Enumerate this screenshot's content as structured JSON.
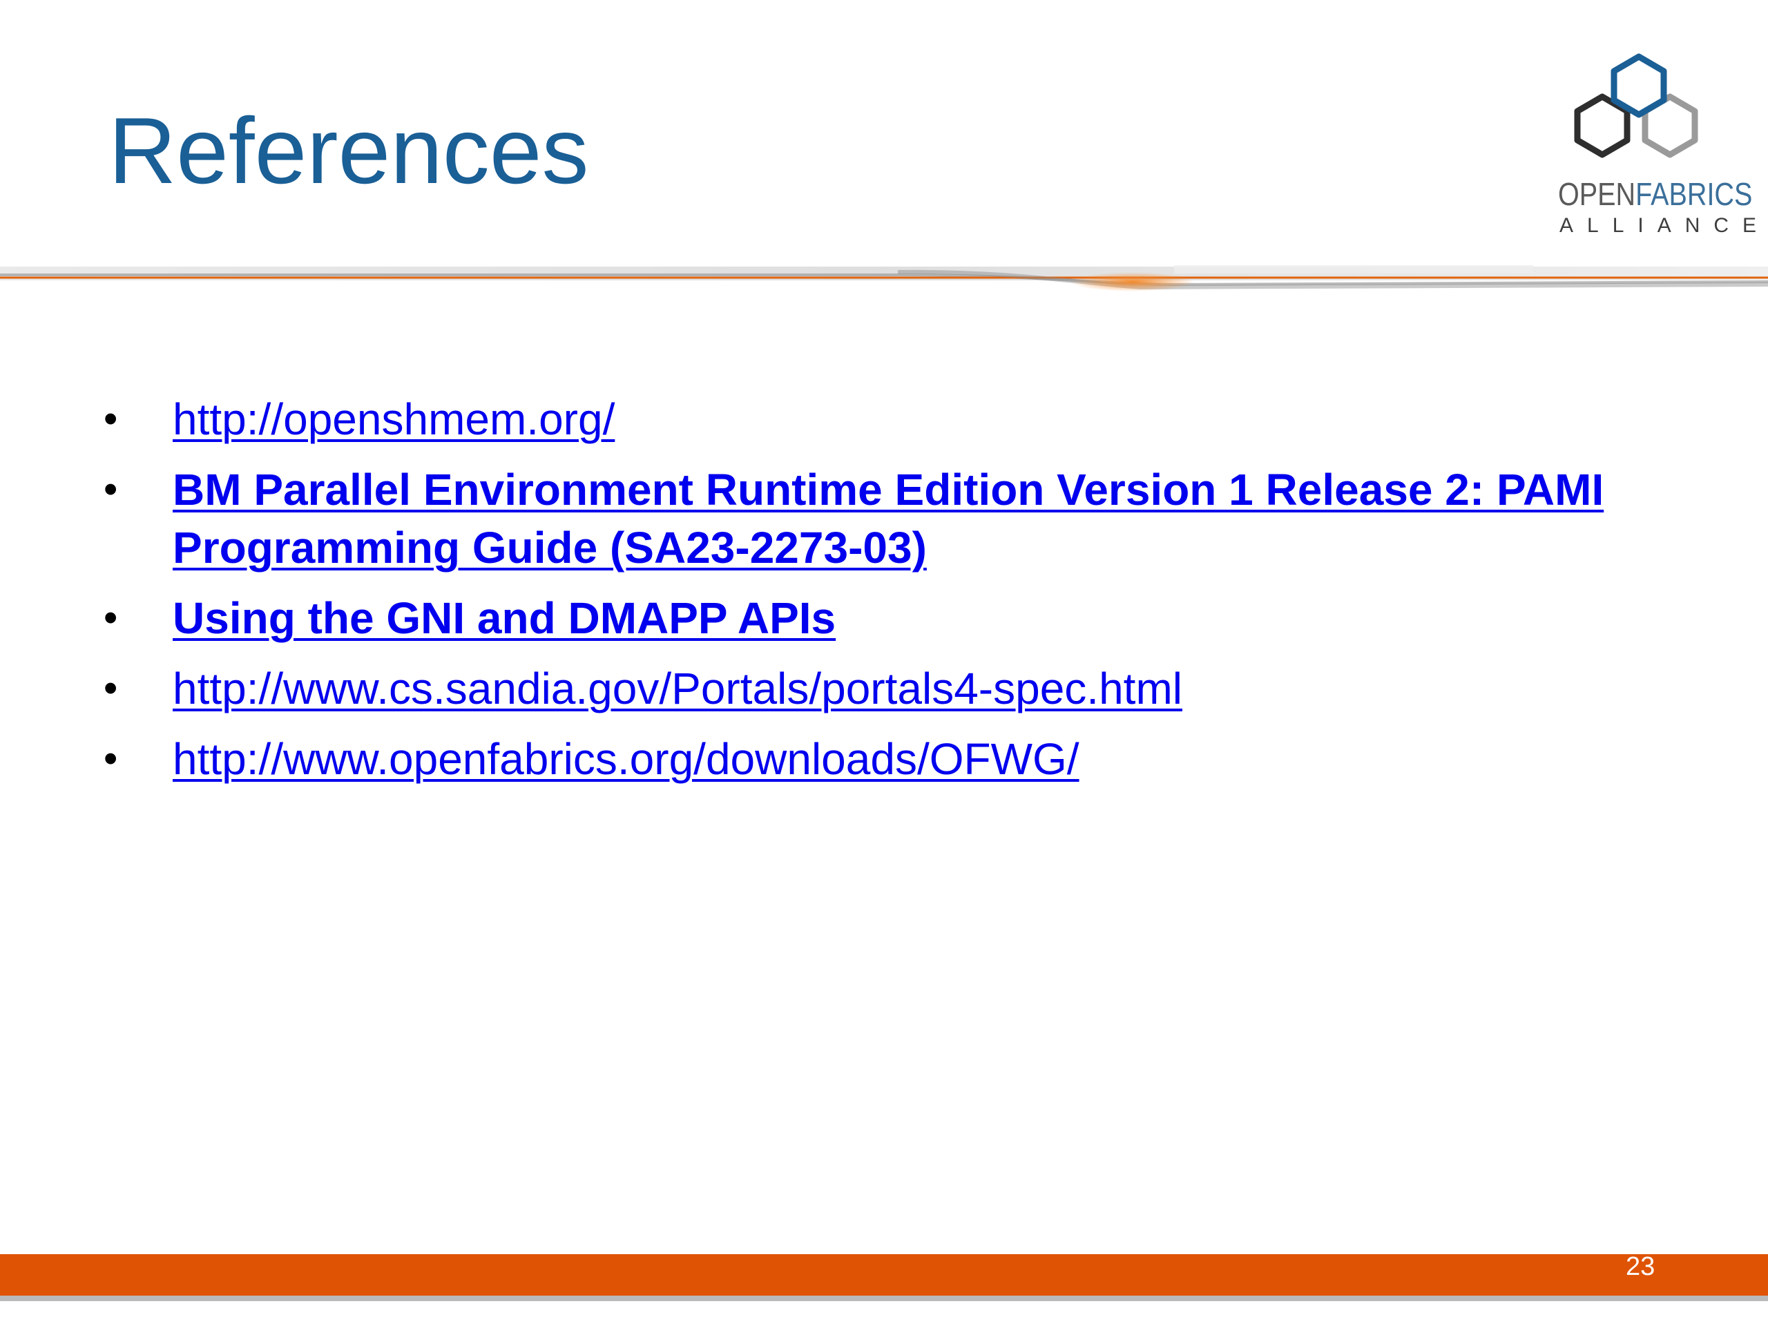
{
  "slide": {
    "title": "References",
    "page_number": "23"
  },
  "logo": {
    "word_open": "OPEN",
    "word_fabrics": "FABRICS",
    "word_alliance": "ALLIANCE"
  },
  "references": [
    {
      "text": "http://openshmem.org/",
      "bold": false
    },
    {
      "text": "BM Parallel Environment Runtime Edition Version 1 Release 2: PAMI Programming Guide (SA23-2273-03)",
      "bold": true
    },
    {
      "text": "Using the GNI and DMAPP APIs",
      "bold": true
    },
    {
      "text": "http://www.cs.sandia.gov/Portals/portals4-spec.html",
      "bold": false
    },
    {
      "text": "http://www.openfabrics.org/downloads/OFWG/",
      "bold": false
    }
  ],
  "bullet_glyph": "•",
  "colors": {
    "title": "#1a5f96",
    "link": "#0000ee",
    "accent_orange": "#df5305",
    "logo_dark_hex": "#2e2e2e",
    "logo_blue_hex": "#1a5f96",
    "logo_grey_hex": "#9a9a9a"
  }
}
